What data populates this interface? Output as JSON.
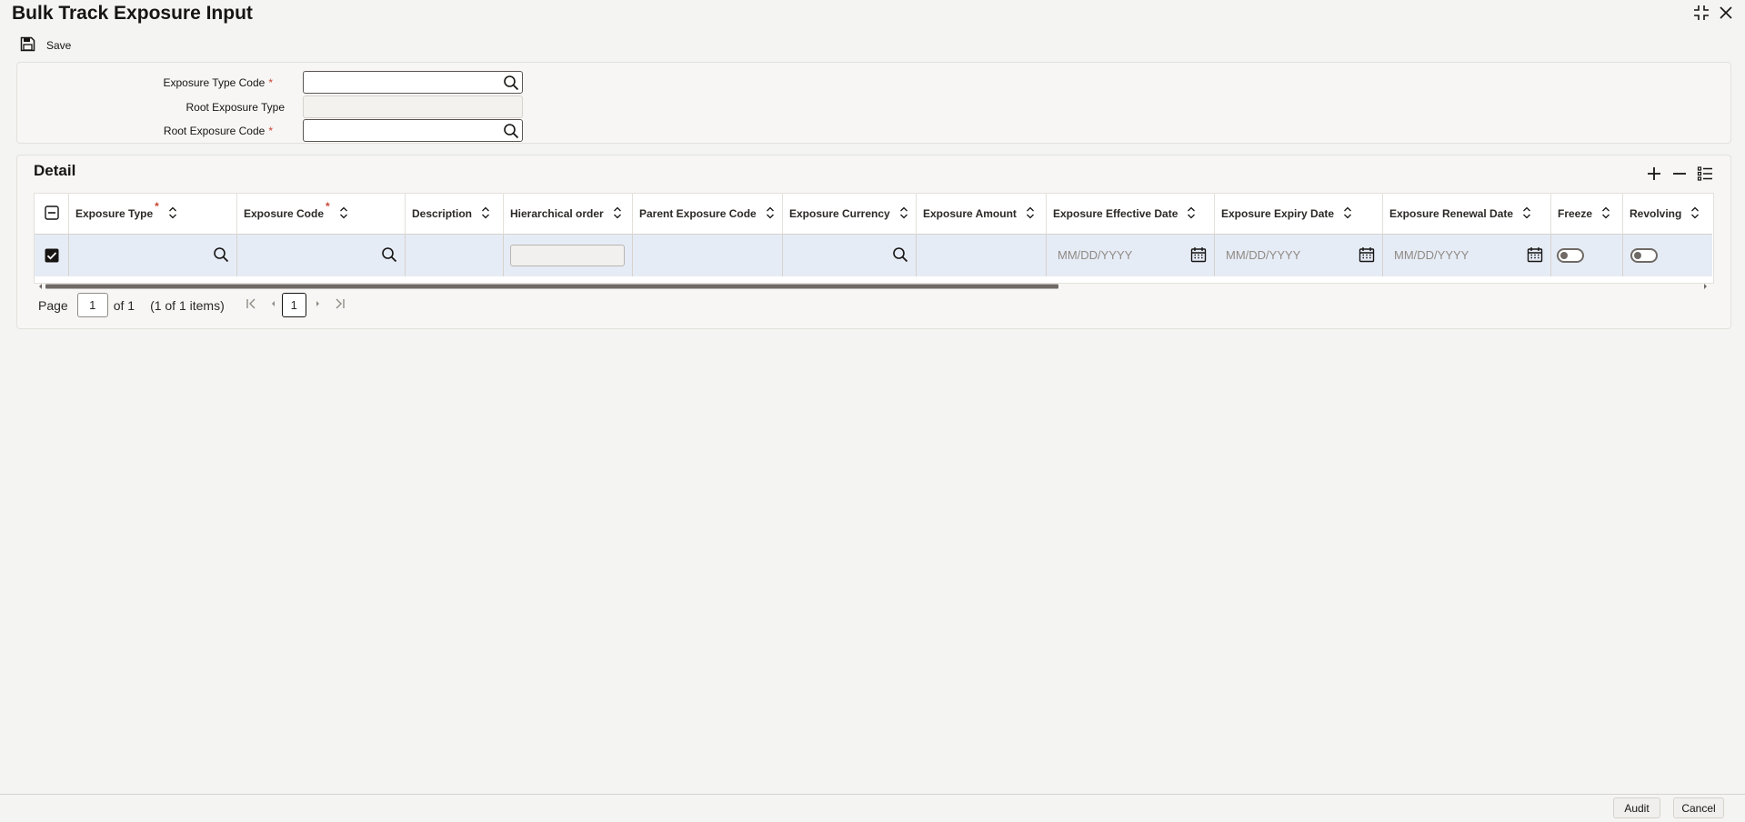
{
  "window": {
    "title": "Bulk Track Exposure Input"
  },
  "toolbar": {
    "save_label": "Save"
  },
  "form": {
    "exposure_type_code": {
      "label": "Exposure Type Code",
      "value": ""
    },
    "root_exposure_type": {
      "label": "Root Exposure Type",
      "value": ""
    },
    "root_exposure_code": {
      "label": "Root Exposure Code",
      "value": ""
    },
    "required_mark": "*"
  },
  "detail": {
    "title": "Detail",
    "columns": [
      "Exposure Type",
      "Exposure Code",
      "Description",
      "Hierarchical order",
      "Parent Exposure Code",
      "Exposure Currency",
      "Exposure Amount",
      "Exposure Effective Date",
      "Exposure Expiry Date",
      "Exposure Renewal Date",
      "Freeze",
      "Revolving"
    ],
    "date_placeholder": "MM/DD/YYYY",
    "row_selected": true,
    "freeze_on": false,
    "revolving_on": false
  },
  "pagination": {
    "page_label": "Page",
    "current_page": "1",
    "of_label": "of 1",
    "items_label": "(1 of 1 items)",
    "page_button": "1"
  },
  "footer": {
    "audit_label": "Audit",
    "cancel_label": "Cancel"
  },
  "colors": {
    "required": "#c74634",
    "row_highlight": "#e6ecf6"
  }
}
